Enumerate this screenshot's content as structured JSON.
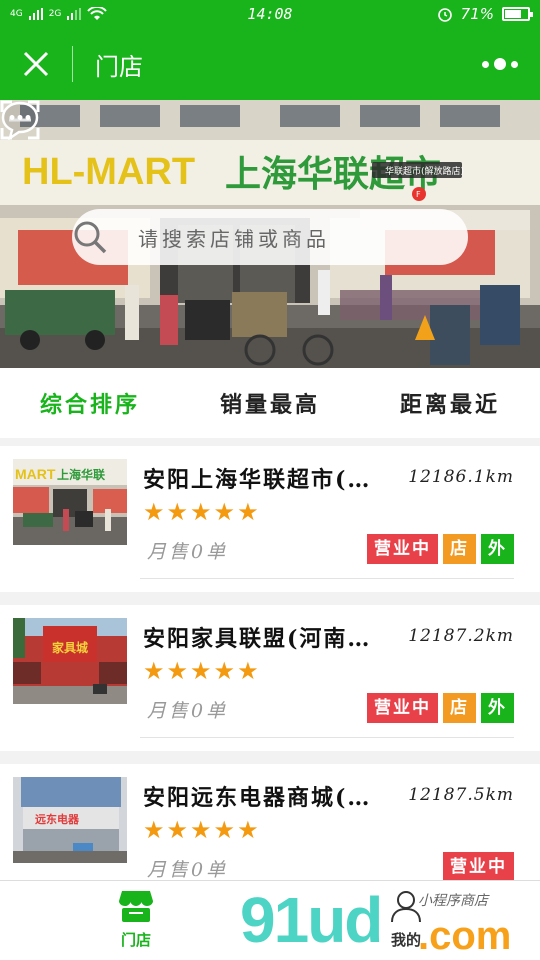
{
  "status_bar": {
    "network_1": "4G",
    "network_2": "2G",
    "time": "14:08",
    "battery_text": "71%",
    "battery_level": 0.71
  },
  "header": {
    "title": "门店"
  },
  "search": {
    "placeholder": "请搜索店铺或商品"
  },
  "banner": {
    "sign_left": "HL-MART",
    "sign_right": "上海华联超市",
    "map_pin_label": "华联超市(解放路店)",
    "slide_count": 2,
    "active_slide": 1
  },
  "sort_tabs": [
    {
      "label": "综合排序",
      "active": true
    },
    {
      "label": "销量最高",
      "active": false
    },
    {
      "label": "距离最近",
      "active": false
    }
  ],
  "stores": [
    {
      "name": "安阳上海华联超市(…",
      "distance": "12186.1km",
      "rating": 5,
      "sales": "月售0单",
      "tags": [
        {
          "label": "营业中",
          "kind": "open"
        },
        {
          "label": "店",
          "kind": "store"
        },
        {
          "label": "外",
          "kind": "out"
        }
      ]
    },
    {
      "name": "安阳家具联盟(河南…",
      "distance": "12187.2km",
      "rating": 5,
      "sales": "月售0单",
      "thumb_sign": "家具城",
      "tags": [
        {
          "label": "营业中",
          "kind": "open"
        },
        {
          "label": "店",
          "kind": "store"
        },
        {
          "label": "外",
          "kind": "out"
        }
      ]
    },
    {
      "name": "安阳远东电器商城(…",
      "distance": "12187.5km",
      "rating": 5,
      "sales": "月售0单",
      "thumb_sign": "远东电器",
      "tags": [
        {
          "label": "营业中",
          "kind": "open"
        }
      ]
    }
  ],
  "bottom_nav": {
    "stores_label": "门店",
    "mine_label": "我的"
  },
  "watermark": {
    "brand": "91ud",
    "suffix": ".com",
    "tagline": "小程序商店"
  },
  "colors": {
    "primary_green": "#19b41c",
    "star_orange": "#f39a10",
    "tag_red": "#e9414a",
    "tag_orange": "#f39a22"
  }
}
